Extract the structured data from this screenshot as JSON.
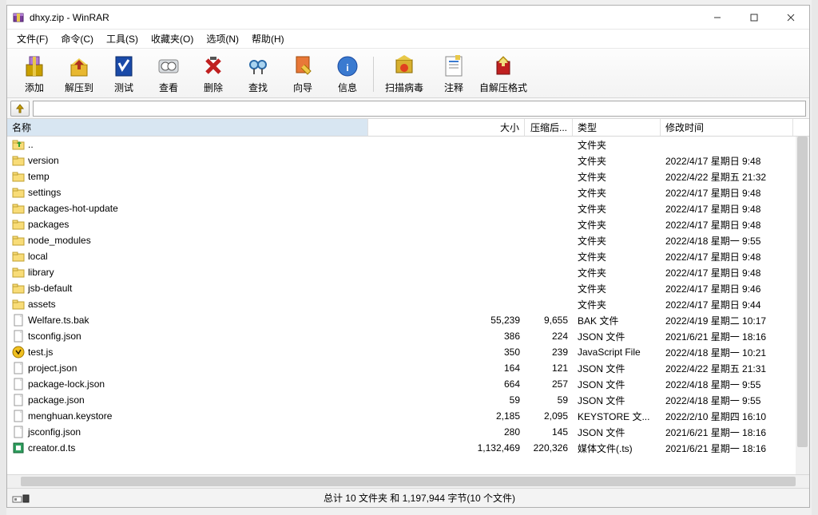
{
  "title": "dhxy.zip - WinRAR",
  "menus": [
    "文件(F)",
    "命令(C)",
    "工具(S)",
    "收藏夹(O)",
    "选项(N)",
    "帮助(H)"
  ],
  "toolbar": [
    {
      "key": "add",
      "label": "添加"
    },
    {
      "key": "extract",
      "label": "解压到"
    },
    {
      "key": "test",
      "label": "测试"
    },
    {
      "key": "view",
      "label": "查看"
    },
    {
      "key": "delete",
      "label": "删除"
    },
    {
      "key": "find",
      "label": "查找"
    },
    {
      "key": "wizard",
      "label": "向导"
    },
    {
      "key": "info",
      "label": "信息"
    },
    {
      "key": "virus",
      "label": "扫描病毒",
      "wide": true
    },
    {
      "key": "comment",
      "label": "注释"
    },
    {
      "key": "sfx",
      "label": "自解压格式",
      "wide": true
    }
  ],
  "columns": {
    "name": "名称",
    "size": "大小",
    "packed": "压缩后...",
    "type": "类型",
    "date": "修改时间"
  },
  "rows": [
    {
      "icon": "up",
      "name": "..",
      "size": "",
      "packed": "",
      "type": "文件夹",
      "date": ""
    },
    {
      "icon": "folder",
      "name": "version",
      "size": "",
      "packed": "",
      "type": "文件夹",
      "date": "2022/4/17 星期日 9:48"
    },
    {
      "icon": "folder",
      "name": "temp",
      "size": "",
      "packed": "",
      "type": "文件夹",
      "date": "2022/4/22 星期五 21:32"
    },
    {
      "icon": "folder",
      "name": "settings",
      "size": "",
      "packed": "",
      "type": "文件夹",
      "date": "2022/4/17 星期日 9:48"
    },
    {
      "icon": "folder",
      "name": "packages-hot-update",
      "size": "",
      "packed": "",
      "type": "文件夹",
      "date": "2022/4/17 星期日 9:48"
    },
    {
      "icon": "folder",
      "name": "packages",
      "size": "",
      "packed": "",
      "type": "文件夹",
      "date": "2022/4/17 星期日 9:48"
    },
    {
      "icon": "folder",
      "name": "node_modules",
      "size": "",
      "packed": "",
      "type": "文件夹",
      "date": "2022/4/18 星期一 9:55"
    },
    {
      "icon": "folder",
      "name": "local",
      "size": "",
      "packed": "",
      "type": "文件夹",
      "date": "2022/4/17 星期日 9:48"
    },
    {
      "icon": "folder",
      "name": "library",
      "size": "",
      "packed": "",
      "type": "文件夹",
      "date": "2022/4/17 星期日 9:48"
    },
    {
      "icon": "folder",
      "name": "jsb-default",
      "size": "",
      "packed": "",
      "type": "文件夹",
      "date": "2022/4/17 星期日 9:46"
    },
    {
      "icon": "folder",
      "name": "assets",
      "size": "",
      "packed": "",
      "type": "文件夹",
      "date": "2022/4/17 星期日 9:44"
    },
    {
      "icon": "file",
      "name": "Welfare.ts.bak",
      "size": "55,239",
      "packed": "9,655",
      "type": "BAK 文件",
      "date": "2022/4/19 星期二 10:17"
    },
    {
      "icon": "file",
      "name": "tsconfig.json",
      "size": "386",
      "packed": "224",
      "type": "JSON 文件",
      "date": "2021/6/21 星期一 18:16"
    },
    {
      "icon": "js",
      "name": "test.js",
      "size": "350",
      "packed": "239",
      "type": "JavaScript File",
      "date": "2022/4/18 星期一 10:21"
    },
    {
      "icon": "file",
      "name": "project.json",
      "size": "164",
      "packed": "121",
      "type": "JSON 文件",
      "date": "2022/4/22 星期五 21:31"
    },
    {
      "icon": "file",
      "name": "package-lock.json",
      "size": "664",
      "packed": "257",
      "type": "JSON 文件",
      "date": "2022/4/18 星期一 9:55"
    },
    {
      "icon": "file",
      "name": "package.json",
      "size": "59",
      "packed": "59",
      "type": "JSON 文件",
      "date": "2022/4/18 星期一 9:55"
    },
    {
      "icon": "file",
      "name": "menghuan.keystore",
      "size": "2,185",
      "packed": "2,095",
      "type": "KEYSTORE 文...",
      "date": "2022/2/10 星期四 16:10"
    },
    {
      "icon": "file",
      "name": "jsconfig.json",
      "size": "280",
      "packed": "145",
      "type": "JSON 文件",
      "date": "2021/6/21 星期一 18:16"
    },
    {
      "icon": "ts",
      "name": "creator.d.ts",
      "size": "1,132,469",
      "packed": "220,326",
      "type": "媒体文件(.ts)",
      "date": "2021/6/21 星期一 18:16"
    }
  ],
  "status": "总计 10 文件夹 和 1,197,944 字节(10 个文件)"
}
